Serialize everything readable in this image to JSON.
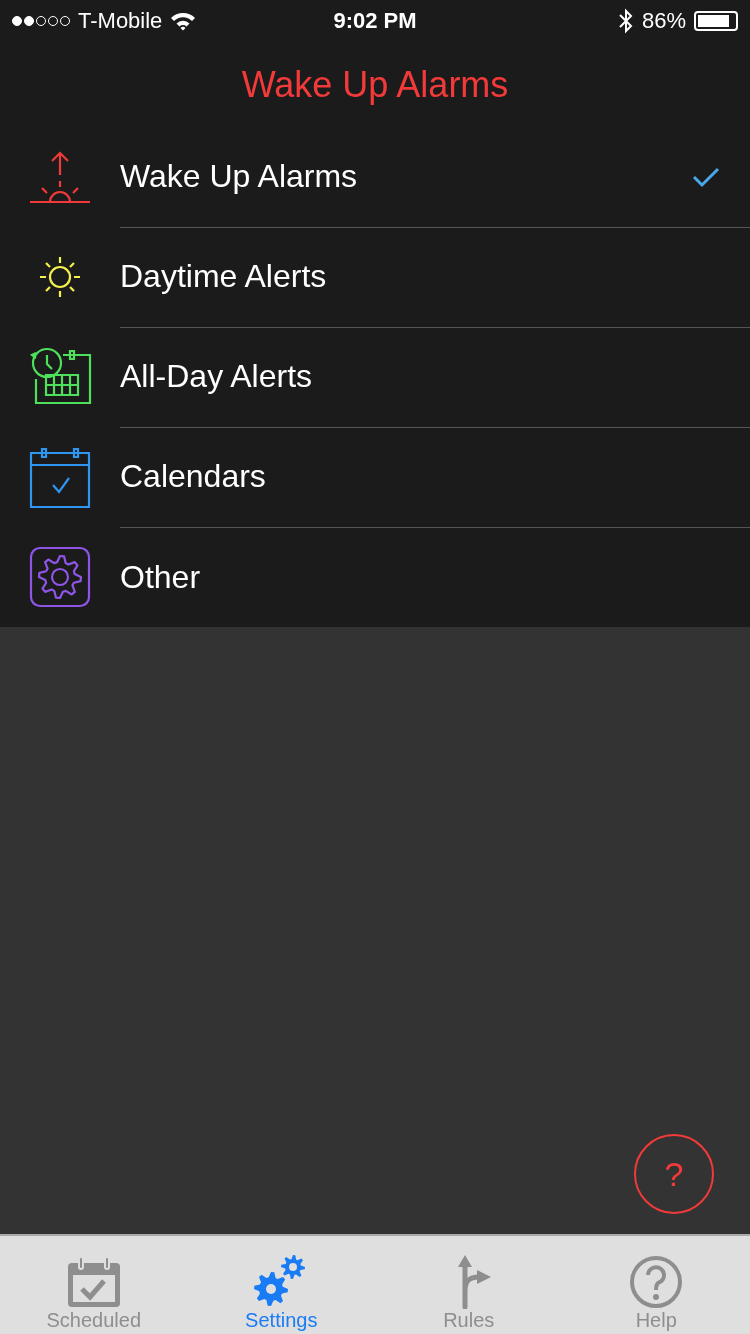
{
  "status_bar": {
    "carrier": "T-Mobile",
    "time": "9:02 PM",
    "battery": "86%"
  },
  "title": "Wake Up Alarms",
  "items": [
    {
      "label": "Wake Up Alarms",
      "kind": "sunrise",
      "color": "#f23a3a",
      "selected": true
    },
    {
      "label": "Daytime Alerts",
      "kind": "sun",
      "color": "#f5f04a",
      "selected": false
    },
    {
      "label": "All-Day Alerts",
      "kind": "clock-calendar",
      "color": "#4ee05a",
      "selected": false
    },
    {
      "label": "Calendars",
      "kind": "calendar",
      "color": "#2e95f0",
      "selected": false
    },
    {
      "label": "Other",
      "kind": "gear",
      "color": "#8f55e8",
      "selected": false
    }
  ],
  "help_button": {
    "label": "?"
  },
  "tabs": [
    {
      "label": "Scheduled",
      "kind": "calendar",
      "selected": false
    },
    {
      "label": "Settings",
      "kind": "gears",
      "selected": true
    },
    {
      "label": "Rules",
      "kind": "fork",
      "selected": false
    },
    {
      "label": "Help",
      "kind": "help",
      "selected": false
    }
  ]
}
